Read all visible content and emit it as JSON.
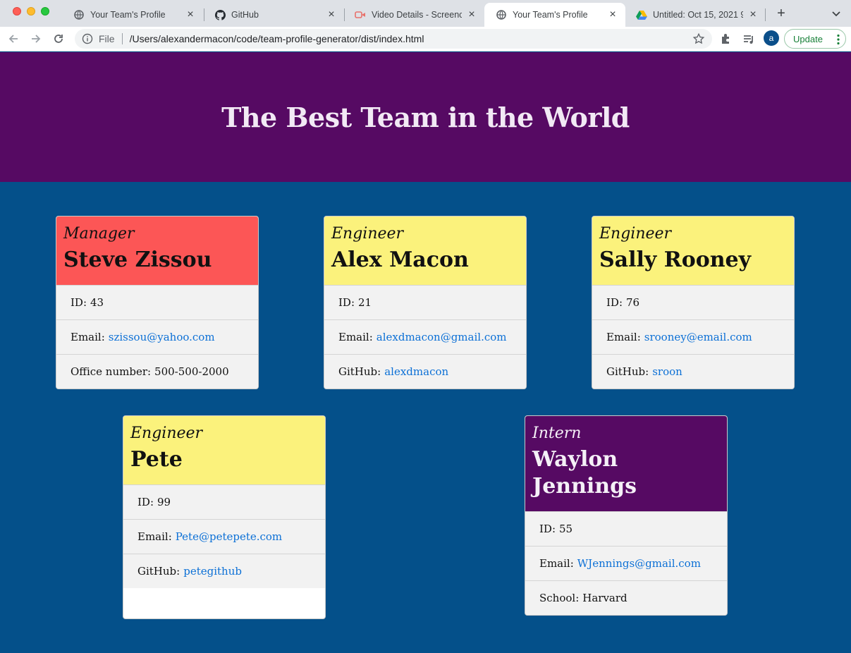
{
  "browser": {
    "tabs": [
      {
        "title": "Your Team's Profile",
        "icon": "globe-icon",
        "active": false
      },
      {
        "title": "GitHub",
        "icon": "github-icon",
        "active": false
      },
      {
        "title": "Video Details - Screenc",
        "icon": "video-icon",
        "active": false
      },
      {
        "title": "Your Team's Profile",
        "icon": "globe-icon",
        "active": true
      },
      {
        "title": "Untitled: Oct 15, 2021 9",
        "icon": "drive-icon",
        "active": false
      }
    ],
    "close_glyph": "×",
    "new_tab_glyph": "+",
    "address": {
      "scheme_label": "File",
      "url": "/Users/alexandermacon/code/team-profile-generator/dist/index.html"
    },
    "profile_initial": "a",
    "update_label": "Update"
  },
  "page": {
    "title": "The Best Team in the World"
  },
  "team": [
    {
      "role": "Manager",
      "name": "Steve Zissou",
      "id_label": "ID:",
      "id": "43",
      "email_label": "Email:",
      "email": "szissou@yahoo.com",
      "extra_label": "Office number:",
      "extra": "500-500-2000",
      "extra_is_link": false
    },
    {
      "role": "Engineer",
      "name": "Alex Macon",
      "id_label": "ID:",
      "id": "21",
      "email_label": "Email:",
      "email": "alexdmacon@gmail.com",
      "extra_label": "GitHub:",
      "extra": "alexdmacon",
      "extra_is_link": true
    },
    {
      "role": "Engineer",
      "name": "Sally Rooney",
      "id_label": "ID:",
      "id": "76",
      "email_label": "Email:",
      "email": "srooney@email.com",
      "extra_label": "GitHub:",
      "extra": "sroon",
      "extra_is_link": true
    },
    {
      "role": "Engineer",
      "name": "Pete",
      "id_label": "ID:",
      "id": "99",
      "email_label": "Email:",
      "email": "Pete@petepete.com",
      "extra_label": "GitHub:",
      "extra": "petegithub",
      "extra_is_link": true
    },
    {
      "role": "Intern",
      "name": "Waylon Jennings",
      "id_label": "ID:",
      "id": "55",
      "email_label": "Email:",
      "email": "WJennings@gmail.com",
      "extra_label": "School:",
      "extra": "Harvard",
      "extra_is_link": false
    }
  ],
  "colors": {
    "page_background": "#04508a",
    "header_background": "#560a63",
    "manager_header": "#fc5656",
    "engineer_header": "#fbf27c",
    "intern_header": "#560a63",
    "link": "#0c70d6"
  }
}
